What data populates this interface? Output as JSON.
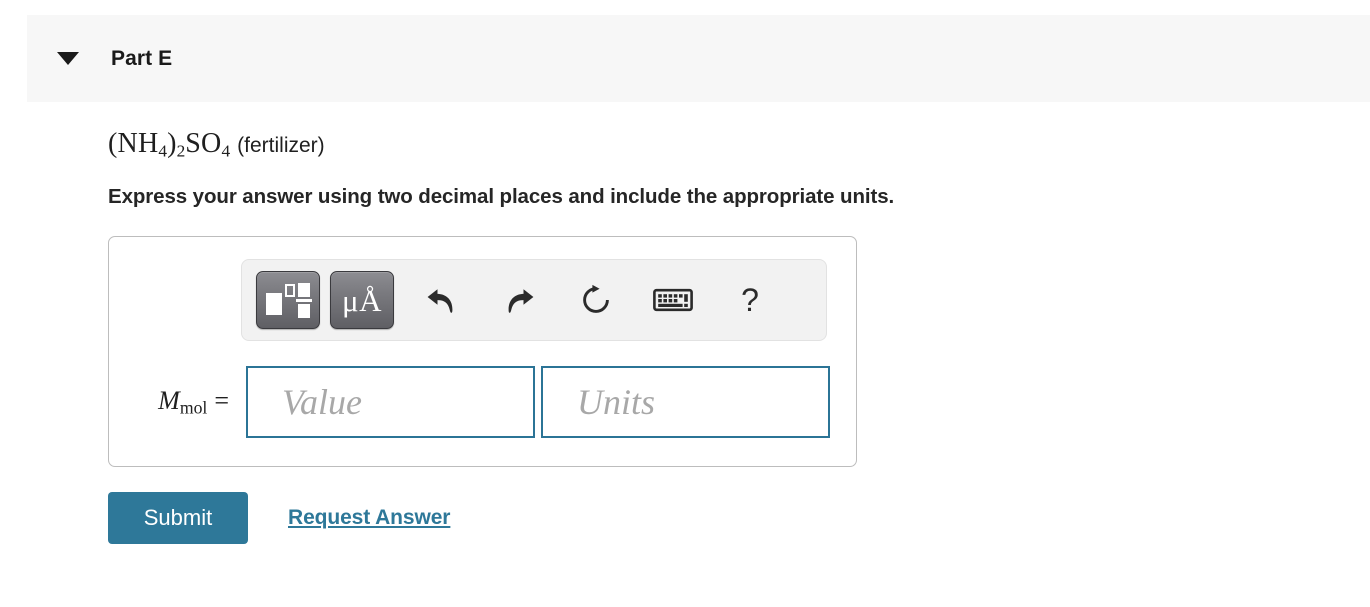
{
  "header": {
    "part_label": "Part E",
    "disclosure_icon": "triangle-down-icon",
    "background_color": "#f7f7f7"
  },
  "question": {
    "formula_main": "(NH",
    "formula_sub1": "4",
    "formula_mid": ")",
    "formula_sub2": "2",
    "formula_tail": "SO",
    "formula_sub3": "4",
    "formula_note": "(fertilizer)",
    "formula_plain": "(NH4)2SO4 (fertilizer)",
    "instruction": "Express your answer using two decimal places and include the appropriate units."
  },
  "toolbar": {
    "buttons": [
      {
        "name": "template-icon",
        "label": "math-template"
      },
      {
        "name": "units-icon",
        "label": "μÅ"
      },
      {
        "name": "undo-icon",
        "label": "Undo"
      },
      {
        "name": "redo-icon",
        "label": "Redo"
      },
      {
        "name": "reset-icon",
        "label": "Reset"
      },
      {
        "name": "keyboard-icon",
        "label": "Keyboard shortcuts"
      },
      {
        "name": "help-icon",
        "label": "?"
      }
    ],
    "units_button_label": "μÅ",
    "help_label": "?",
    "background_color": "#f2f2f2"
  },
  "answer": {
    "variable_symbol": "M",
    "variable_subscript": "mol",
    "equals_sign": "=",
    "value_placeholder": "Value",
    "value_text": "",
    "units_placeholder": "Units",
    "units_text": "",
    "input_border_color": "#2b7496"
  },
  "actions": {
    "submit_label": "Submit",
    "request_answer_label": "Request Answer",
    "accent_color": "#2e7899"
  }
}
